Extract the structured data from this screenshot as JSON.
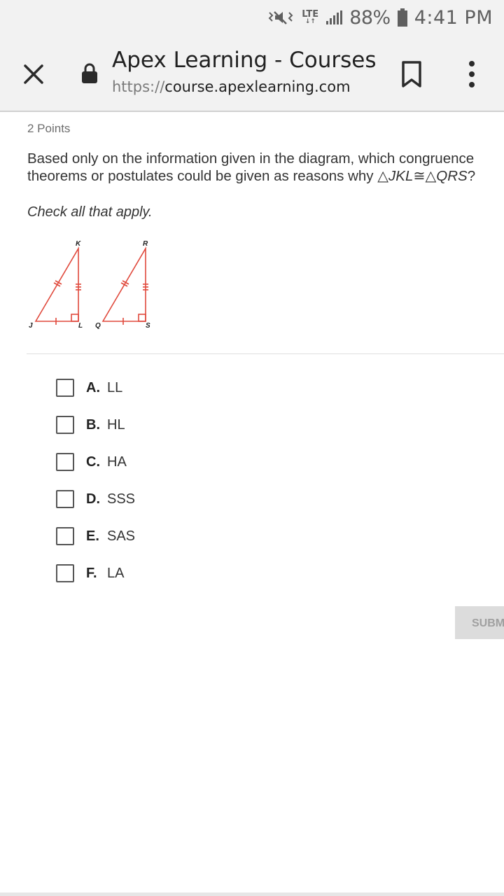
{
  "status_bar": {
    "network": "LTE",
    "battery": "88%",
    "time": "4:41 PM",
    "icons": [
      "mute-icon",
      "lte-icon",
      "signal-icon",
      "battery-icon"
    ]
  },
  "browser": {
    "page_title": "Apex Learning - Courses",
    "url_scheme": "https://",
    "url_host": "course.apexlearning.com",
    "icons": [
      "close-icon",
      "lock-icon",
      "bookmark-icon",
      "more-vert-icon"
    ]
  },
  "question": {
    "points": "2 Points",
    "prompt_text": "Based only on the information given in the diagram, which congruence theorems or postulates could be given as reasons why ",
    "triangle_1": "JKL",
    "congruent_symbol": "≅",
    "triangle_2": "QRS",
    "prompt_end": "?",
    "instruction": "Check all that apply.",
    "diagram": {
      "triangle_1_labels": [
        "K",
        "J",
        "L"
      ],
      "triangle_2_labels": [
        "R",
        "Q",
        "S"
      ],
      "stroke_color": "#e0493c"
    },
    "choices": [
      {
        "letter": "A.",
        "text": "LL",
        "checked": false
      },
      {
        "letter": "B.",
        "text": "HL",
        "checked": false
      },
      {
        "letter": "C.",
        "text": "HA",
        "checked": false
      },
      {
        "letter": "D.",
        "text": "SSS",
        "checked": false
      },
      {
        "letter": "E.",
        "text": "SAS",
        "checked": false
      },
      {
        "letter": "F.",
        "text": "LA",
        "checked": false
      }
    ],
    "submit_label": "SUBMIT"
  }
}
